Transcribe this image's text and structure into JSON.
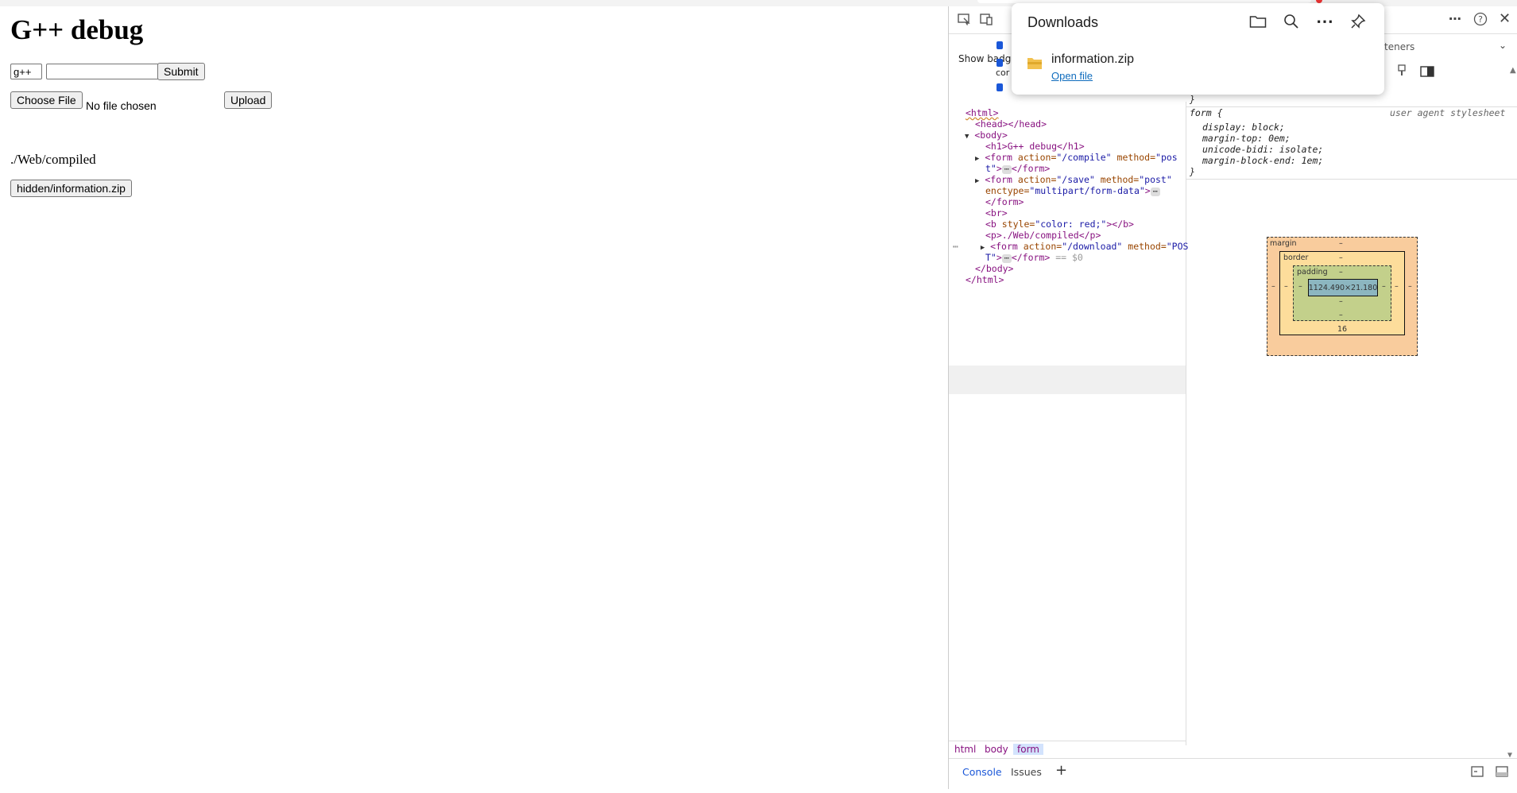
{
  "page": {
    "heading": "G++ debug",
    "compile_form": {
      "command_value": "g++",
      "args_value": "",
      "submit_label": "Submit"
    },
    "upload_form": {
      "choose_label": "Choose File",
      "file_status": "No file chosen",
      "upload_label": "Upload"
    },
    "path_text": "./Web/compiled",
    "download_button_label": "hidden/information.zip"
  },
  "downloads": {
    "title": "Downloads",
    "items": [
      {
        "filename": "information.zip",
        "action": "Open file"
      }
    ],
    "icons": [
      "folder-icon",
      "search-icon",
      "more-icon",
      "pin-icon"
    ]
  },
  "devtools": {
    "show_badges_label": "Show badges",
    "partial_label": "cor",
    "listeners_tab_partial": "teners",
    "dom_tree": {
      "l1": "<html>",
      "l2": "<head></head>",
      "l3": "<body>",
      "l4": "<h1>G++ debug</h1>",
      "l5_tag": "<form ",
      "l5_attr1": "action=",
      "l5_val1": "\"/compile\"",
      "l5_attr2": " method=",
      "l5_val2": "\"pos",
      "l6_val": "t\"",
      "l6_tag": ">",
      "l6_end": "</form>",
      "l7_tag": "<form ",
      "l7_attr1": "action=",
      "l7_val1": "\"/save\"",
      "l7_attr2": " method=",
      "l7_val2": "\"post\"",
      "l8_attr": "enctype=",
      "l8_val": "\"multipart/form-data\"",
      "l8_tag": ">",
      "l9": "</form>",
      "l10": "<br>",
      "l11_tag": "<b ",
      "l11_attr": "style=",
      "l11_val": "\"color: red;\"",
      "l11_end": "></b>",
      "l12": "<p>./Web/compiled</p>",
      "l13_tag": "<form ",
      "l13_attr1": "action=",
      "l13_val1": "\"/download\"",
      "l13_attr2": " method=",
      "l13_val2": "\"POS",
      "l14_val": "T\"",
      "l14_tag": ">",
      "l14_end": "</form>",
      "l14_ref": " == $0",
      "l15": "</body>",
      "l16": "</html>"
    },
    "breadcrumbs": [
      "html",
      "body",
      "form"
    ],
    "styles": {
      "brace_close": "}",
      "rule_selector": "form {",
      "rule_source": "user agent stylesheet",
      "decls": [
        "display: block;",
        "margin-top: 0em;",
        "unicode-bidi: isolate;",
        "margin-block-end: 1em;"
      ]
    },
    "box_model": {
      "margin_label": "margin",
      "border_label": "border",
      "padding_label": "padding",
      "content_size": "1124.490×21.180",
      "dash": "–",
      "margin_bottom": "16"
    },
    "bottom_tabs": [
      "Console",
      "Issues"
    ],
    "add_tab_label": "+"
  }
}
